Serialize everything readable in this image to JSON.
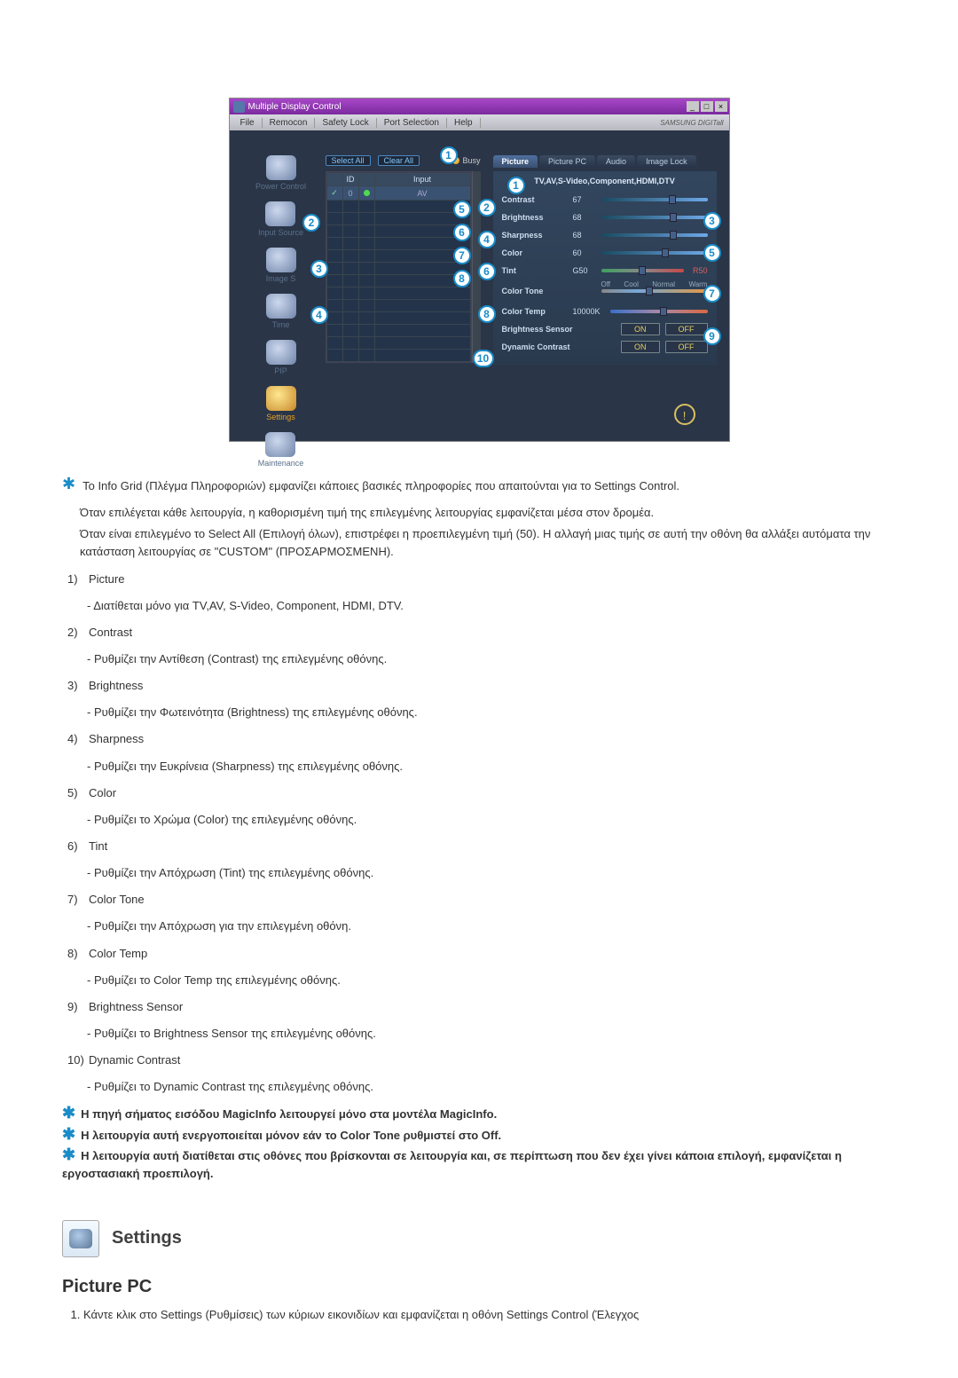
{
  "window": {
    "title": "Multiple Display Control",
    "menubar": {
      "file": "File",
      "remocon": "Remocon",
      "safety_lock": "Safety Lock",
      "port_selection": "Port Selection",
      "help": "Help"
    },
    "brand": "SAMSUNG DIGITall"
  },
  "sidebar": {
    "power": "Power Control",
    "input": "Input Source",
    "image": "Image S",
    "time": "Time",
    "pip": "PIP",
    "settings": "Settings",
    "maintenance": "Maintenance"
  },
  "gridheader": {
    "select_all": "Select All",
    "clear_all": "Clear All",
    "busy": "Busy"
  },
  "gridcols": {
    "chk": "",
    "id": "ID",
    "st": "",
    "input": "Input"
  },
  "gridrows": [
    {
      "id": "0",
      "input": "AV",
      "selected": true,
      "led": true
    }
  ],
  "tabs": {
    "picture": "Picture",
    "picturepc": "Picture PC",
    "audio": "Audio",
    "imagelock": "Image Lock"
  },
  "panel": {
    "head": "TV,AV,S-Video,Component,HDMI,DTV",
    "contrast": {
      "label": "Contrast",
      "value": "67"
    },
    "brightness": {
      "label": "Brightness",
      "value": "68"
    },
    "sharpness": {
      "label": "Sharpness",
      "value": "68"
    },
    "color": {
      "label": "Color",
      "value": "60"
    },
    "tint": {
      "label": "Tint",
      "value": "G50",
      "r": "R50"
    },
    "colortone": {
      "label": "Color Tone",
      "off": "Off",
      "cool": "Cool",
      "normal": "Normal",
      "warm": "Warm"
    },
    "colortemp": {
      "label": "Color Temp",
      "value": "10000K"
    },
    "brightsensor": {
      "label": "Brightness Sensor",
      "on": "ON",
      "off": "OFF"
    },
    "dyncontrast": {
      "label": "Dynamic Contrast",
      "on": "ON",
      "off": "OFF"
    }
  },
  "text": {
    "infogrid": "Το Info Grid (Πλέγμα Πληροφοριών) εμφανίζει κάποιες βασικές πληροφορίες που απαιτούνται για το Settings Control.",
    "para1": "Όταν επιλέγεται κάθε λειτουργία, η καθορισμένη τιμή της επιλεγμένης λειτουργίας εμφανίζεται μέσα στον δρομέα.",
    "para2": "Όταν είναι επιλεγμένο το Select All (Επιλογή όλων), επιστρέφει η προεπιλεγμένη τιμή (50). Η αλλαγή μιας τιμής σε αυτή την οθόνη θα αλλάξει αυτόματα την κατάσταση λειτουργίας σε \"CUSTOM\" (ΠΡΟΣΑΡΜΟΣΜΕΝΗ).",
    "defs": [
      {
        "n": "1)",
        "t": "Picture",
        "b": "- Διατίθεται μόνο για TV,AV, S-Video, Component, HDMI, DTV."
      },
      {
        "n": "2)",
        "t": "Contrast",
        "b": "- Ρυθμίζει την Αντίθεση (Contrast) της επιλεγμένης οθόνης."
      },
      {
        "n": "3)",
        "t": "Brightness",
        "b": "- Ρυθμίζει την Φωτεινότητα (Brightness) της επιλεγμένης οθόνης."
      },
      {
        "n": "4)",
        "t": "Sharpness",
        "b": "- Ρυθμίζει την Ευκρίνεια (Sharpness) της επιλεγμένης οθόνης."
      },
      {
        "n": "5)",
        "t": "Color",
        "b": "- Ρυθμίζει το Χρώμα (Color) της επιλεγμένης οθόνης."
      },
      {
        "n": "6)",
        "t": "Tint",
        "b": "- Ρυθμίζει την Απόχρωση (Tint) της επιλεγμένης οθόνης."
      },
      {
        "n": "7)",
        "t": "Color Tone",
        "b": "- Ρυθμίζει την Απόχρωση για την επιλεγμένη οθόνη."
      },
      {
        "n": "8)",
        "t": "Color Temp",
        "b": "- Ρυθμίζει το Color Temp της επιλεγμένης οθόνης."
      },
      {
        "n": "9)",
        "t": "Brightness Sensor",
        "b": "- Ρυθμίζει το Brightness Sensor της επιλεγμένης οθόνης."
      },
      {
        "n": "10)",
        "t": "Dynamic Contrast",
        "b": "- Ρυθμίζει το Dynamic Contrast της επιλεγμένης οθόνης."
      }
    ],
    "note1": "Η πηγή σήματος εισόδου MagicInfo λειτουργεί μόνο στα μοντέλα MagicInfo.",
    "note2": "Η λειτουργία αυτή ενεργοποιείται μόνον εάν το Color Tone ρυθμιστεί στο Off.",
    "note3": "Η λειτουργία αυτή διατίθεται στις οθόνες που βρίσκονται σε λειτουργία και, σε περίπτωση που δεν έχει γίνει κάποια επιλογή, εμφανίζεται η εργοστασιακή προεπιλογή."
  },
  "section": {
    "title": "Settings",
    "subheading": "Picture PC",
    "step1": "Κάντε κλικ στο Settings (Ρυθμίσεις) των κύριων εικονιδίων και εμφανίζεται η οθόνη Settings Control (Έλεγχος"
  }
}
